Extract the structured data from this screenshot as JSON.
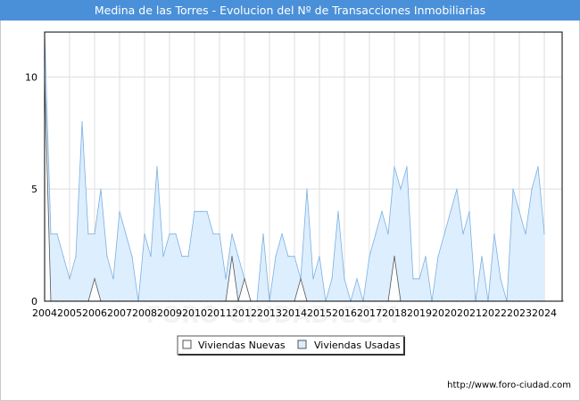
{
  "page": {
    "title": "Medina de las Torres - Evolucion del Nº de Transacciones Inmobiliarias",
    "footer_url": "http://www.foro-ciudad.com",
    "watermark": "FORO-CIUDAD.COM"
  },
  "chart_data": {
    "type": "area",
    "title": "Medina de las Torres - Evolucion del Nº de Transacciones Inmobiliarias",
    "xlabel": "",
    "ylabel": "",
    "x_tick_labels": [
      "2004",
      "2005",
      "2006",
      "2007",
      "2008",
      "2009",
      "2010",
      "2011",
      "2012",
      "2013",
      "2014",
      "2015",
      "2016",
      "2017",
      "2018",
      "2019",
      "2020",
      "2021",
      "2022",
      "2023",
      "2024"
    ],
    "y_ticks": [
      0,
      5,
      10
    ],
    "ylim": [
      0,
      12
    ],
    "x_start": 2004,
    "points_per_year": 4,
    "grid": true,
    "legend_position": "bottom-center",
    "series": [
      {
        "name": "Viviendas Nuevas",
        "color_fill": "#ffffff",
        "color_line": "#555555",
        "values": [
          10,
          0,
          0,
          0,
          0,
          0,
          0,
          0,
          1,
          0,
          0,
          0,
          0,
          0,
          0,
          0,
          0,
          0,
          0,
          0,
          0,
          0,
          0,
          0,
          0,
          0,
          0,
          0,
          0,
          0,
          2,
          0,
          1,
          0,
          0,
          0,
          0,
          0,
          0,
          0,
          0,
          1,
          0,
          0,
          0,
          0,
          0,
          0,
          0,
          0,
          0,
          0,
          0,
          0,
          0,
          0,
          2,
          0,
          0,
          0,
          0,
          0,
          0,
          0,
          0,
          0,
          0,
          0,
          0,
          0,
          0,
          0,
          0,
          0,
          0,
          0,
          0,
          0,
          0,
          0,
          0,
          0,
          0,
          0
        ]
      },
      {
        "name": "Viviendas Usadas",
        "color_fill": "#ddeeff",
        "color_line": "#7ab0e0",
        "values": [
          13,
          3,
          3,
          2,
          1,
          2,
          8,
          3,
          3,
          5,
          2,
          1,
          4,
          3,
          2,
          0,
          3,
          2,
          6,
          2,
          3,
          3,
          2,
          2,
          4,
          4,
          4,
          3,
          3,
          1,
          3,
          2,
          1,
          0,
          0,
          3,
          0,
          2,
          3,
          2,
          2,
          1,
          5,
          1,
          2,
          0,
          1,
          4,
          1,
          0,
          1,
          0,
          2,
          3,
          4,
          3,
          6,
          5,
          6,
          1,
          1,
          2,
          0,
          2,
          3,
          4,
          5,
          3,
          4,
          0,
          2,
          0,
          3,
          1,
          0,
          5,
          4,
          3,
          5,
          6,
          3
        ]
      }
    ]
  },
  "colors": {
    "title_bar": "#4a90d9",
    "plot_border": "#000000",
    "grid": "#dddddd"
  }
}
